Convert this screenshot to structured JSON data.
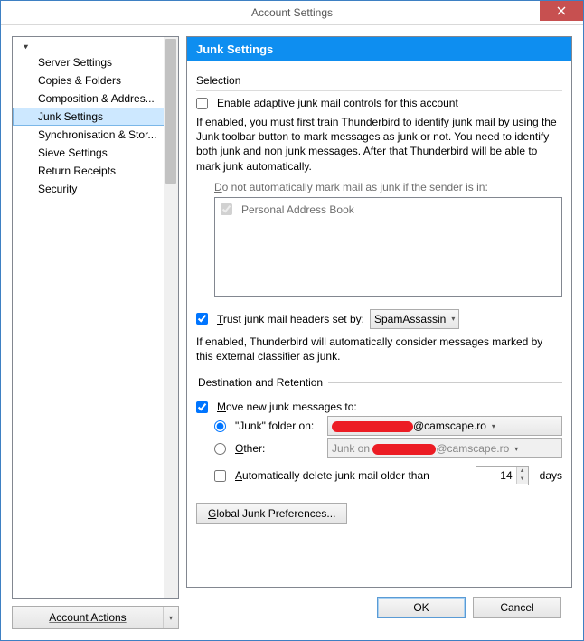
{
  "window": {
    "title": "Account Settings"
  },
  "sidebar": {
    "items": [
      "Server Settings",
      "Copies & Folders",
      "Composition & Addres...",
      "Junk Settings",
      "Synchronisation & Stor...",
      "Sieve Settings",
      "Return Receipts",
      "Security"
    ],
    "selected_index": 3,
    "account_actions": "Account Actions"
  },
  "panel": {
    "heading": "Junk Settings",
    "section_selection": "Selection",
    "enable_label": "Enable adaptive junk mail controls for this account",
    "enable_help": "If enabled, you must first train Thunderbird to identify junk mail by using the Junk toolbar button to mark messages as junk or not. You need to identify both junk and non junk messages. After that Thunderbird will be able to mark junk automatically.",
    "whitelist_label_pre": "D",
    "whitelist_label_rest": "o not automatically mark mail as junk if the sender is in:",
    "whitelist_items": [
      "Personal Address Book"
    ],
    "trust_label_pre": "T",
    "trust_label_rest": "rust junk mail headers set by:",
    "trust_value": "SpamAssassin",
    "trust_help": "If enabled, Thunderbird will automatically consider messages marked by this external classifier as junk.",
    "dest_legend": "Destination and Retention",
    "move_label_pre": "M",
    "move_label_rest": "ove new junk messages to:",
    "junk_folder_label": "\"Junk\" folder on:",
    "junk_folder_value_suffix": "@camscape.ro",
    "other_label_pre": "O",
    "other_label_rest": "ther:",
    "other_value_prefix": "Junk on ",
    "other_value_suffix": "@camscape.ro",
    "autodel_pre": "A",
    "autodel_rest": "utomatically delete junk mail older than",
    "autodel_days": "14",
    "autodel_unit": "days",
    "global_btn_pre": "G",
    "global_btn_rest": "lobal Junk Preferences..."
  },
  "footer": {
    "ok": "OK",
    "cancel": "Cancel"
  }
}
